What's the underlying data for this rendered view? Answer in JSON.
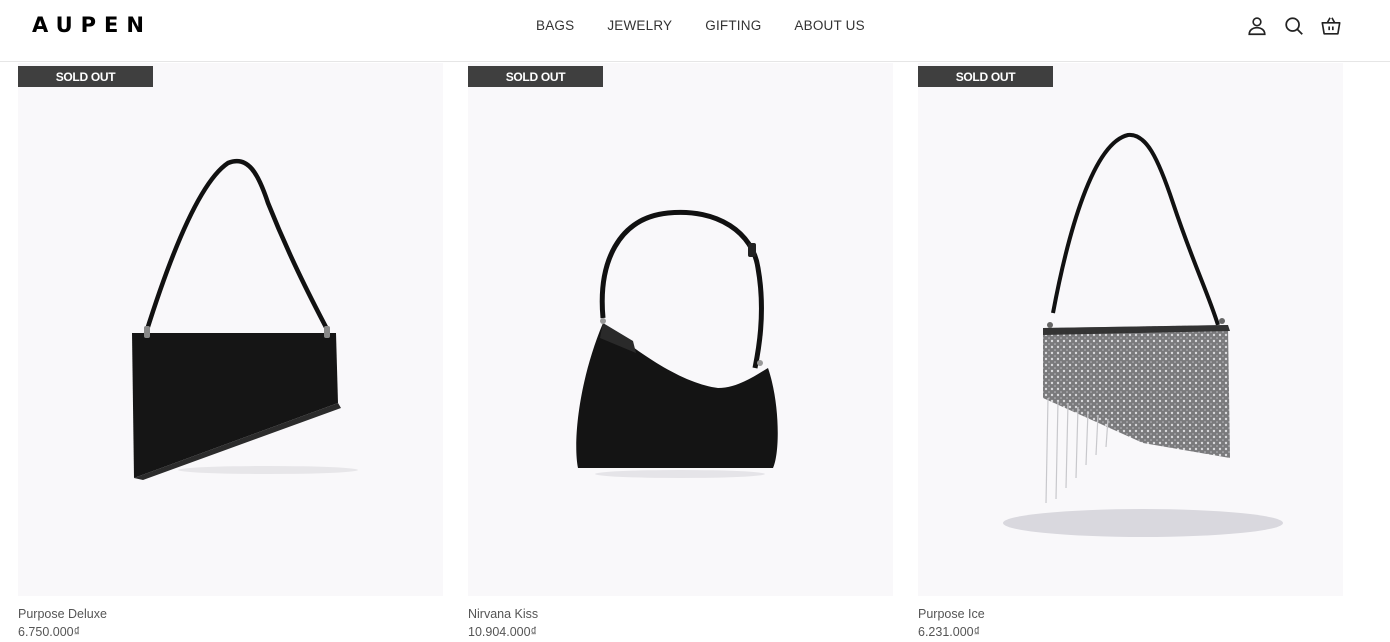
{
  "header": {
    "logo": "AUPEN",
    "nav": [
      "BAGS",
      "JEWELRY",
      "GIFTING",
      "ABOUT US"
    ],
    "icons": [
      "account-icon",
      "search-icon",
      "cart-icon"
    ]
  },
  "products": [
    {
      "badge": "SOLD OUT",
      "title": "Purpose Deluxe",
      "price": "6.750.000₫"
    },
    {
      "badge": "SOLD OUT",
      "title": "Nirvana Kiss",
      "price": "10.904.000₫"
    },
    {
      "badge": "SOLD OUT",
      "title": "Purpose Ice",
      "price": "6.231.000₫"
    }
  ]
}
